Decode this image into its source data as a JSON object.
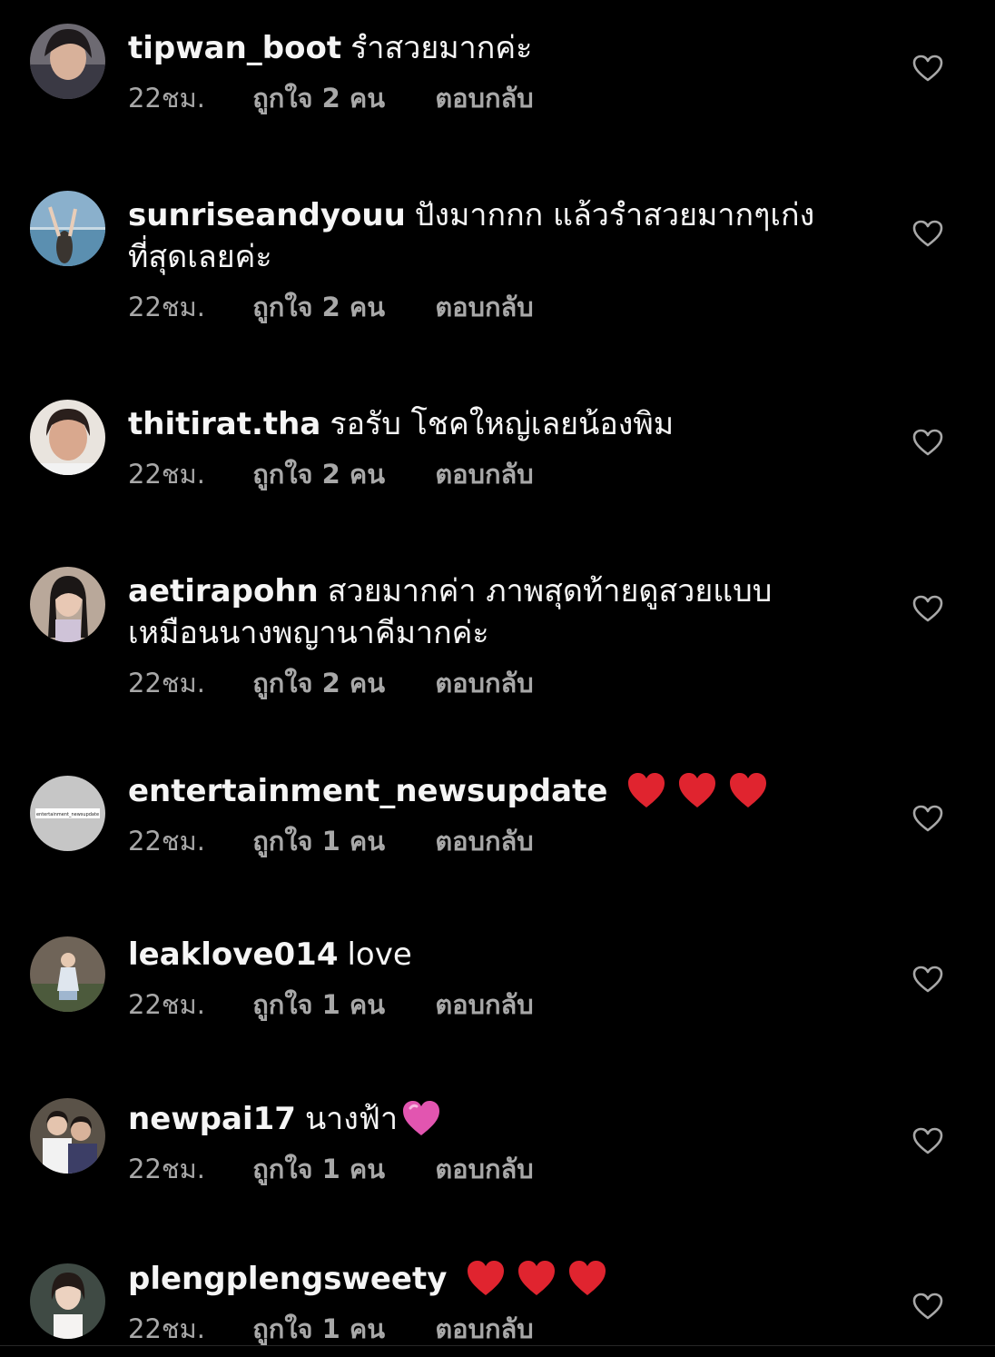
{
  "comments": [
    {
      "username": "tipwan_boot",
      "text": "รำสวยมากค่ะ",
      "time": "22ชม.",
      "likes": "ถูกใจ 2 คน",
      "reply": "ตอบกลับ"
    },
    {
      "username": "sunriseandyouu",
      "text": "ปังมากกก แล้วรำสวยมากๆเก่งที่สุดเลยค่ะ",
      "time": "22ชม.",
      "likes": "ถูกใจ 2 คน",
      "reply": "ตอบกลับ"
    },
    {
      "username": "thitirat.tha",
      "text": "รอรับ โชคใหญ่เลยน้องพิม",
      "time": "22ชม.",
      "likes": "ถูกใจ 2 คน",
      "reply": "ตอบกลับ"
    },
    {
      "username": "aetirapohn",
      "text": "สวยมากค่า ภาพสุดท้ายดูสวยแบบเหมือนนางพญานาคีมากค่ะ",
      "time": "22ชม.",
      "likes": "ถูกใจ 2 คน",
      "reply": "ตอบกลับ"
    },
    {
      "username": "entertainment_newsupdate",
      "text": "",
      "emoji": [
        "red-heart",
        "red-heart",
        "red-heart"
      ],
      "avatar_label": "entertainment_newsupdate",
      "time": "22ชม.",
      "likes": "ถูกใจ 1 คน",
      "reply": "ตอบกลับ"
    },
    {
      "username": "leaklove014",
      "text": "love",
      "time": "22ชม.",
      "likes": "ถูกใจ 1 คน",
      "reply": "ตอบกลับ"
    },
    {
      "username": "newpai17",
      "text": "นางฟ้า",
      "emoji": [
        "pink-heart"
      ],
      "time": "22ชม.",
      "likes": "ถูกใจ 1 คน",
      "reply": "ตอบกลับ"
    },
    {
      "username": "plengplengsweety",
      "text": "",
      "emoji": [
        "red-heart",
        "red-heart",
        "red-heart"
      ],
      "time": "22ชม.",
      "likes": "ถูกใจ 1 คน",
      "reply": "ตอบกลับ"
    }
  ],
  "icons": {
    "like": "heart-outline-icon",
    "emoji_red": "#e0242f",
    "emoji_pink": "#e255b0"
  },
  "colors": {
    "background": "#000000",
    "text": "#f5f5f5",
    "secondary": "#a8a8a8"
  }
}
